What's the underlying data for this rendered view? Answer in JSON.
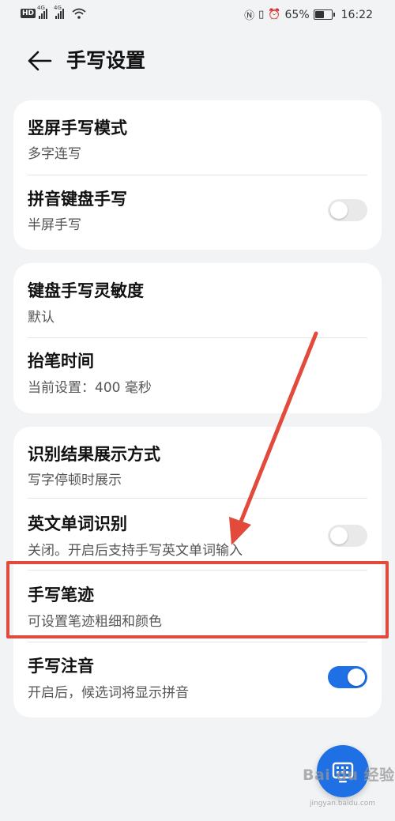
{
  "status_bar": {
    "hd_label": "HD",
    "net_label_1": "4G",
    "net_label_2": "4G",
    "battery_percent": "65%",
    "battery_level": 0.65,
    "time": "16:22",
    "icons": [
      "hd-icon",
      "signal-icon",
      "signal-icon",
      "wifi-icon",
      "nfc-icon",
      "vibrate-icon",
      "alarm-icon",
      "battery-icon"
    ]
  },
  "header": {
    "back_icon": "arrow-left-icon",
    "title": "手写设置"
  },
  "sections": [
    {
      "items": [
        {
          "title": "竖屏手写模式",
          "subtitle": "多字连写"
        },
        {
          "title": "拼音键盘手写",
          "subtitle": "半屏手写",
          "toggle": false
        }
      ]
    },
    {
      "items": [
        {
          "title": "键盘手写灵敏度",
          "subtitle": "默认"
        },
        {
          "title": "抬笔时间",
          "subtitle": "当前设置：400 毫秒"
        }
      ]
    },
    {
      "items": [
        {
          "title": "识别结果展示方式",
          "subtitle": "写字停顿时展示"
        },
        {
          "title": "英文单词识别",
          "subtitle": "关闭。开启后支持手写英文单词输入",
          "toggle": false
        },
        {
          "title": "手写笔迹",
          "subtitle": "可设置笔迹粗细和颜色"
        },
        {
          "title": "手写注音",
          "subtitle": "开启后，候选词将显示拼音",
          "toggle": true
        }
      ]
    }
  ],
  "annotation": {
    "color": "#e24a3c",
    "highlighted_item": "手写笔迹"
  },
  "fab": {
    "icon": "keyboard-icon",
    "color": "#1f6fe5"
  },
  "watermark": {
    "text": "Bai du 经验",
    "subtext": "jingyan.baidu.com"
  },
  "colors": {
    "accent": "#1f6fe5",
    "background": "#f1f3f5",
    "card": "#ffffff"
  }
}
